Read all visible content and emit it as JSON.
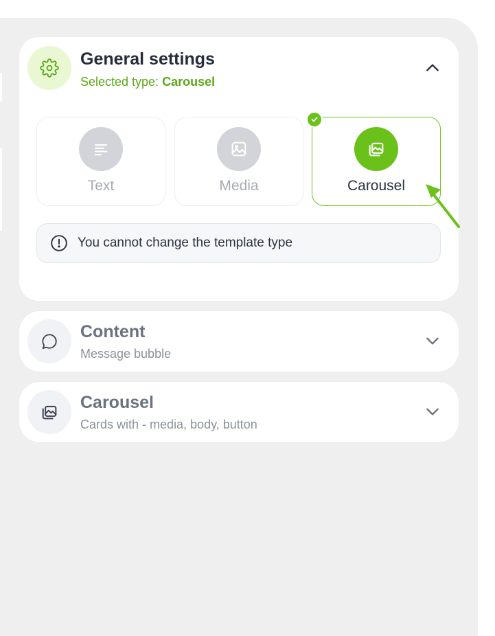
{
  "general_settings": {
    "title": "General settings",
    "subtitle_prefix": "Selected type:",
    "subtitle_value": "Carousel",
    "icon": "gear-icon",
    "expanded": true,
    "types": [
      {
        "label": "Text",
        "icon": "text-lines-icon",
        "selected": false
      },
      {
        "label": "Media",
        "icon": "image-icon",
        "selected": false
      },
      {
        "label": "Carousel",
        "icon": "gallery-icon",
        "selected": true
      }
    ],
    "notice": "You cannot change the template type"
  },
  "content_section": {
    "title": "Content",
    "subtitle": "Message bubble",
    "icon": "chat-bubble-icon",
    "expanded": false
  },
  "carousel_section": {
    "title": "Carousel",
    "subtitle": "Cards with - media, body, button",
    "icon": "gallery-icon",
    "expanded": false
  },
  "colors": {
    "accent": "#69c11a",
    "accent_light": "#e9f8d3",
    "panel_bg": "#efefef"
  }
}
